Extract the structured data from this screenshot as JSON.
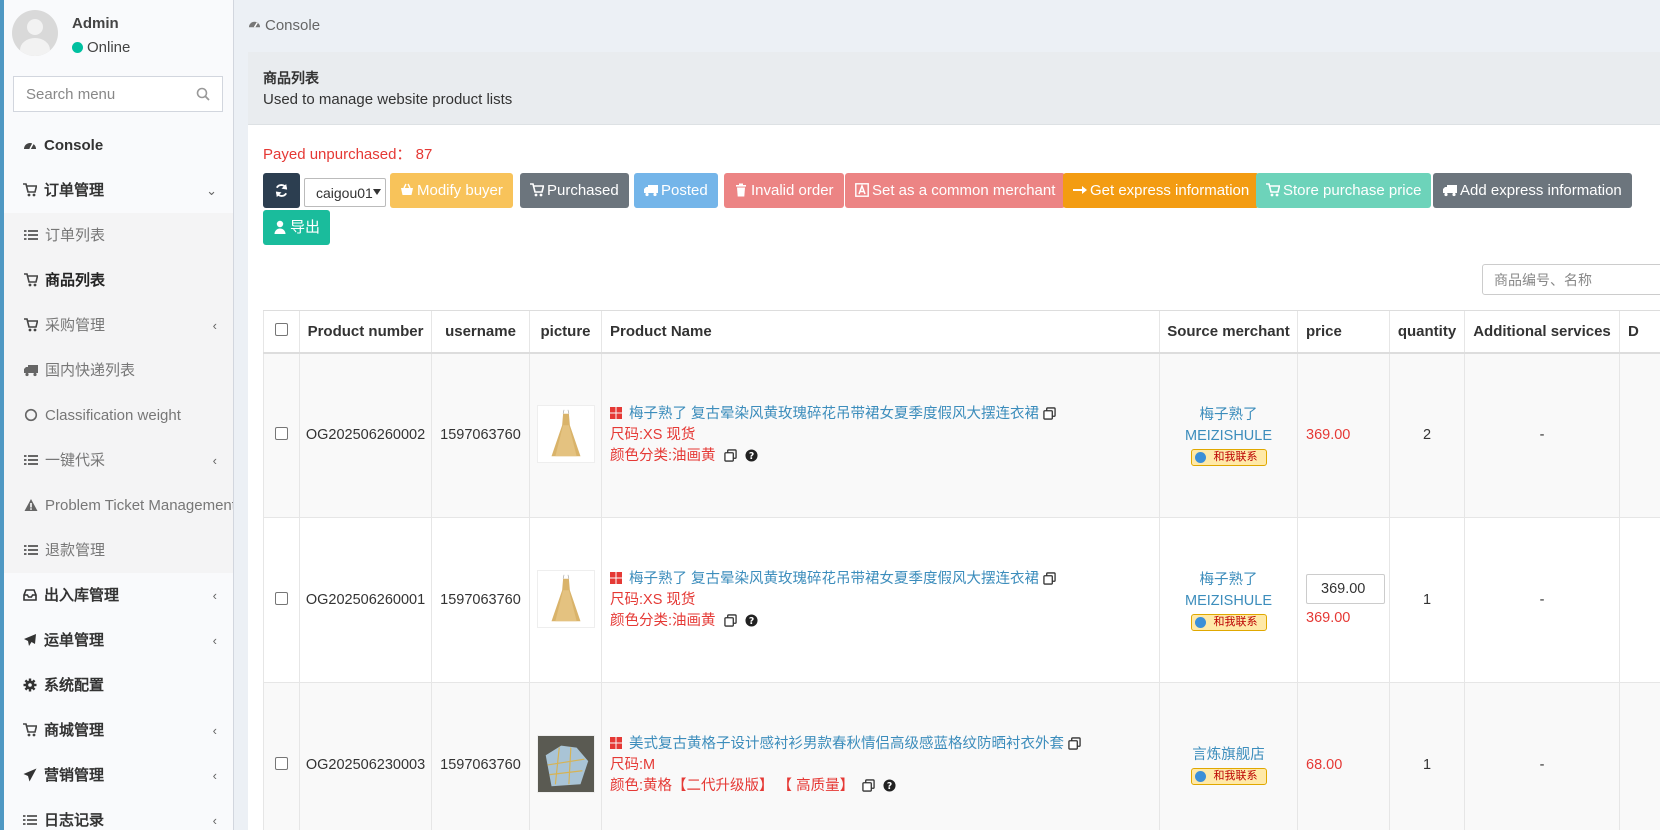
{
  "user": {
    "name": "Admin",
    "status": "Online"
  },
  "sidebar": {
    "search_placeholder": "Search menu",
    "items": [
      {
        "label": "Console",
        "kind": "top",
        "icon": "dashboard-icon"
      },
      {
        "label": "订单管理",
        "kind": "open",
        "icon": "cart-icon",
        "chevron": "⌄"
      },
      {
        "label": "订单列表",
        "kind": "sub",
        "icon": "list-icon"
      },
      {
        "label": "商品列表",
        "kind": "sub-active",
        "icon": "cart-icon"
      },
      {
        "label": "采购管理",
        "kind": "sub",
        "icon": "cart-icon",
        "chevron": "‹"
      },
      {
        "label": "国内快递列表",
        "kind": "sub",
        "icon": "truck-icon"
      },
      {
        "label": "Classification weight",
        "kind": "sub",
        "icon": "circle-icon"
      },
      {
        "label": "一键代采",
        "kind": "sub",
        "icon": "list-icon",
        "chevron": "‹"
      },
      {
        "label": "Problem Ticket Management",
        "kind": "sub",
        "icon": "warning-icon"
      },
      {
        "label": "退款管理",
        "kind": "sub",
        "icon": "list-icon"
      },
      {
        "label": "出入库管理",
        "kind": "top",
        "icon": "inbox-icon",
        "chevron": "‹"
      },
      {
        "label": "运单管理",
        "kind": "top",
        "icon": "plane-icon",
        "chevron": "‹"
      },
      {
        "label": "系统配置",
        "kind": "top",
        "icon": "gear-icon"
      },
      {
        "label": "商城管理",
        "kind": "top",
        "icon": "cart-icon",
        "chevron": "‹"
      },
      {
        "label": "营销管理",
        "kind": "top",
        "icon": "send-icon",
        "chevron": "‹"
      },
      {
        "label": "日志记录",
        "kind": "top",
        "icon": "list-icon",
        "chevron": "‹"
      }
    ]
  },
  "breadcrumb": "Console",
  "page": {
    "title": "商品列表",
    "description": "Used to manage website product lists"
  },
  "payed_unpurchased": {
    "label": "Payed unpurchased：",
    "count": "87"
  },
  "toolbar": {
    "buyer_select": "caigou01",
    "buttons": {
      "modify_buyer": "Modify buyer",
      "purchased": "Purchased",
      "posted": "Posted",
      "invalid_order": "Invalid order",
      "set_common_merchant": "Set as a common merchant",
      "get_express": "Get express information",
      "store_price": "Store purchase price",
      "add_express": "Add express information",
      "export": "导出"
    }
  },
  "table_search_placeholder": "商品编号、名称",
  "table": {
    "columns": [
      "Product number",
      "username",
      "picture",
      "Product Name",
      "Source merchant",
      "price",
      "quantity",
      "Additional services",
      "D"
    ],
    "rows": [
      {
        "product_number": "OG202506260002",
        "username": "1597063760",
        "product_name": "梅子熟了 复古晕染风黄玫瑰碎花吊带裙女夏季度假风大摆连衣裙",
        "attr1": "尺码:XS 现货",
        "attr2": "颜色分类:油画黄",
        "merchant_line1": "梅子熟了",
        "merchant_line2": "MEIZISHULE",
        "contact_badge": "和我联系",
        "price_input": "",
        "price": "369.00",
        "quantity": "2",
        "additional": "-"
      },
      {
        "product_number": "OG202506260001",
        "username": "1597063760",
        "product_name": "梅子熟了 复古晕染风黄玫瑰碎花吊带裙女夏季度假风大摆连衣裙",
        "attr1": "尺码:XS 现货",
        "attr2": "颜色分类:油画黄",
        "merchant_line1": "梅子熟了",
        "merchant_line2": "MEIZISHULE",
        "contact_badge": "和我联系",
        "price_input": "369.00",
        "price": "369.00",
        "quantity": "1",
        "additional": "-"
      },
      {
        "product_number": "OG202506230003",
        "username": "1597063760",
        "product_name": "美式复古黄格子设计感衬衫男款春秋情侣高级感蓝格纹防晒衬衣外套",
        "attr1": "尺码:M",
        "attr2": "颜色:黄格【二代升级版】 【 高质量】",
        "merchant_line1": "言炼旗舰店",
        "merchant_line2": "",
        "contact_badge": "和我联系",
        "price_input": "",
        "price": "68.00",
        "quantity": "1",
        "additional": "-"
      }
    ]
  }
}
